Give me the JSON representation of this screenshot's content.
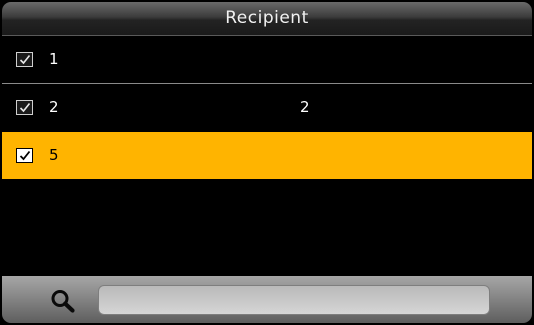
{
  "header": {
    "title": "Recipient"
  },
  "recipients": [
    {
      "col1": "1",
      "col2": "",
      "checked": true
    },
    {
      "col1": "2",
      "col2": "2",
      "checked": true
    },
    {
      "col1": "5",
      "col2": "",
      "checked": true
    }
  ],
  "selected_index": 2,
  "search": {
    "value": "",
    "placeholder": ""
  },
  "colors": {
    "highlight": "#ffb400",
    "background": "#000000",
    "text": "#ffffff"
  },
  "icons": {
    "search": "search-icon",
    "checkbox": "checkbox-checked-icon"
  }
}
